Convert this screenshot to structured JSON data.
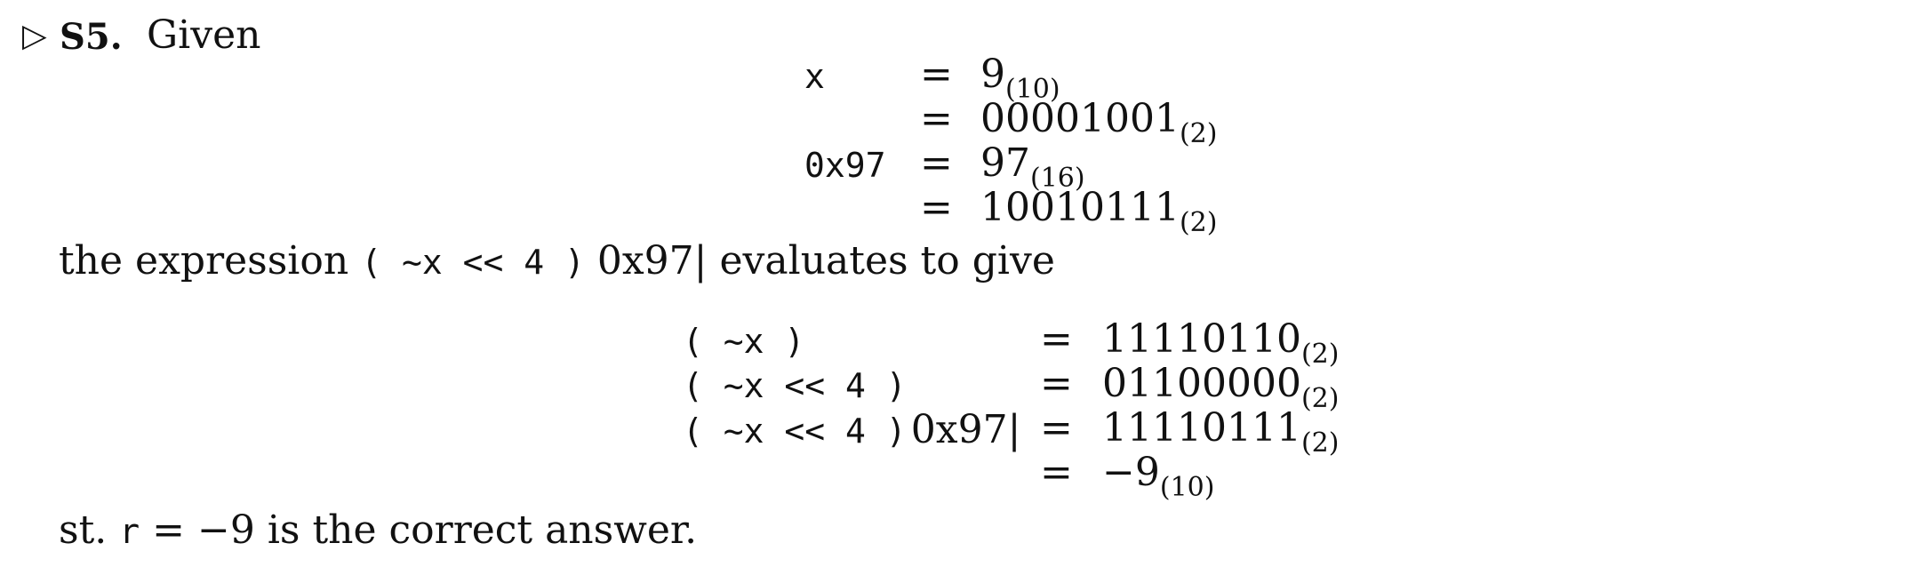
{
  "header": {
    "marker": "▷",
    "label": "S5.",
    "text": "Given"
  },
  "given_block": [
    {
      "lhs": "x",
      "eq": "=",
      "value": "9",
      "base": "(10)"
    },
    {
      "lhs": "",
      "eq": "=",
      "value": "00001001",
      "base": "(2)"
    },
    {
      "lhs": "0x97",
      "eq": "=",
      "value": "97",
      "base": "(16)"
    },
    {
      "lhs": "",
      "eq": "=",
      "value": "10010111",
      "base": "(2)"
    }
  ],
  "intro": {
    "before": "the expression",
    "code": "( ~x << 4 )",
    "after_code": "0x97|",
    "end": "evaluates to give"
  },
  "eval_block": [
    {
      "lhs_code": "( ~x )",
      "lhs_text": "",
      "eq": "=",
      "value": "11110110",
      "base": "(2)"
    },
    {
      "lhs_code": "( ~x << 4 )",
      "lhs_text": "",
      "eq": "=",
      "value": "01100000",
      "base": "(2)"
    },
    {
      "lhs_code": "( ~x << 4 )",
      "lhs_text": "0x97|",
      "eq": "=",
      "value": "11110111",
      "base": "(2)"
    },
    {
      "lhs_code": "",
      "lhs_text": "",
      "eq": "=",
      "value": "−9",
      "base": "(10)"
    }
  ],
  "conclusion": {
    "before": "st.",
    "code": "r",
    "after": "= −9 is the correct answer."
  }
}
